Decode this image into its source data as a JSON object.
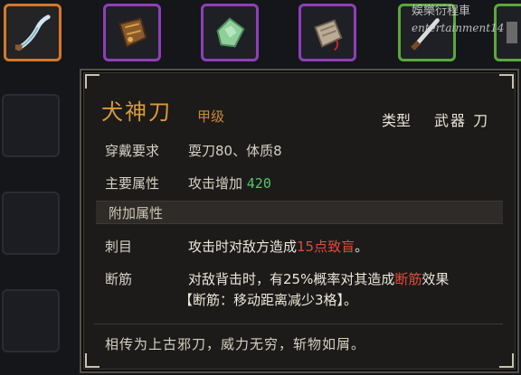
{
  "watermark": {
    "line1": "娛樂衍程車",
    "line2": "entertainment14"
  },
  "inventory": {
    "top_slots": [
      {
        "icon": "curved-blade-icon",
        "border": "#d2782a"
      },
      {
        "icon": "bag-icon",
        "border": "#8e3fb8"
      },
      {
        "icon": "jade-stone-icon",
        "border": "#8e3fb8"
      },
      {
        "icon": "scroll-icon",
        "border": "#8e3fb8"
      },
      {
        "icon": "dagger-icon",
        "border": "#5aa83c"
      },
      {
        "icon": "item-icon",
        "border": "#5aa83c"
      }
    ]
  },
  "tooltip": {
    "name": "犬神刀",
    "grade": "甲级",
    "type_label": "类型",
    "type_value": "武器 刀",
    "requirement": {
      "label": "穿戴要求",
      "value": "耍刀80、体质8"
    },
    "main_attr": {
      "label": "主要属性",
      "text": "攻击增加 ",
      "number": "420"
    },
    "extra_header": "附加属性",
    "effects": [
      {
        "name": "刺目",
        "pre": "攻击时对敌方造成",
        "highlight": "15点致盲",
        "post": "。"
      },
      {
        "name": "断筋",
        "pre": "对敌背击时，有25%概率对其造成",
        "highlight": "断筋",
        "post": "效果",
        "line2": "【断筋：移动距离减少3格】。"
      }
    ],
    "flavor": "相传为上古邪刀，威力无穷，斩物如屑。"
  },
  "colors": {
    "title": "#d89a3a",
    "highlight_red": "#e24a3a",
    "value_green": "#57c46a"
  }
}
